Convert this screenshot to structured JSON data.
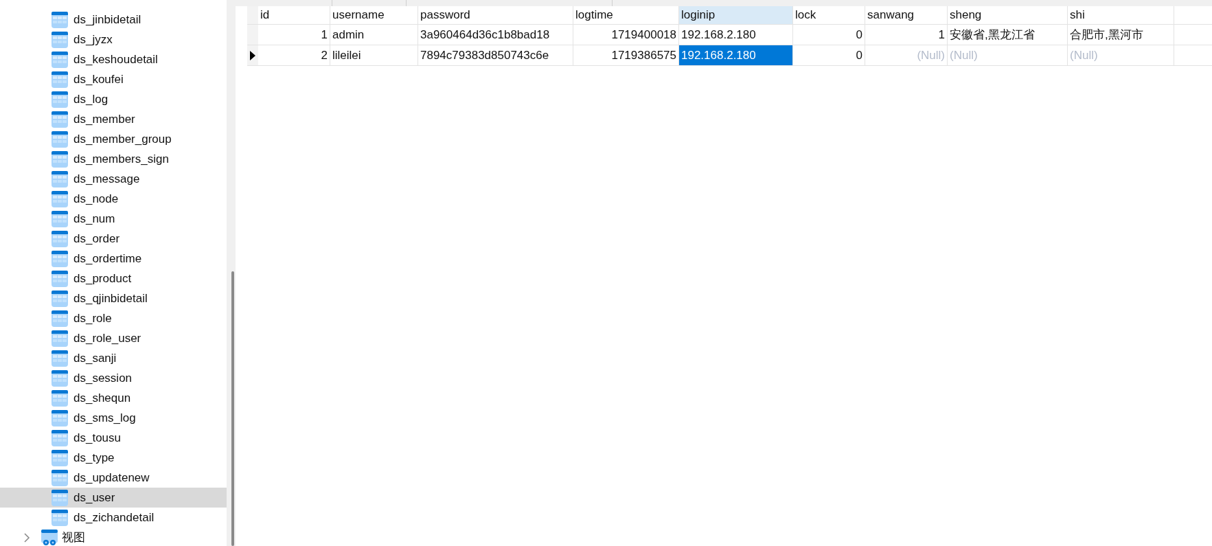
{
  "sidebar": {
    "items": [
      {
        "name": "ds_jinbidetail",
        "selected": false
      },
      {
        "name": "ds_jyzx",
        "selected": false
      },
      {
        "name": "ds_keshoudetail",
        "selected": false
      },
      {
        "name": "ds_koufei",
        "selected": false
      },
      {
        "name": "ds_log",
        "selected": false
      },
      {
        "name": "ds_member",
        "selected": false
      },
      {
        "name": "ds_member_group",
        "selected": false
      },
      {
        "name": "ds_members_sign",
        "selected": false
      },
      {
        "name": "ds_message",
        "selected": false
      },
      {
        "name": "ds_node",
        "selected": false
      },
      {
        "name": "ds_num",
        "selected": false
      },
      {
        "name": "ds_order",
        "selected": false
      },
      {
        "name": "ds_ordertime",
        "selected": false
      },
      {
        "name": "ds_product",
        "selected": false
      },
      {
        "name": "ds_qjinbidetail",
        "selected": false
      },
      {
        "name": "ds_role",
        "selected": false
      },
      {
        "name": "ds_role_user",
        "selected": false
      },
      {
        "name": "ds_sanji",
        "selected": false
      },
      {
        "name": "ds_session",
        "selected": false
      },
      {
        "name": "ds_shequn",
        "selected": false
      },
      {
        "name": "ds_sms_log",
        "selected": false
      },
      {
        "name": "ds_tousu",
        "selected": false
      },
      {
        "name": "ds_type",
        "selected": false
      },
      {
        "name": "ds_updatenew",
        "selected": false
      },
      {
        "name": "ds_user",
        "selected": true
      },
      {
        "name": "ds_zichandetail",
        "selected": false
      }
    ],
    "folder": {
      "label": "视图",
      "expanded": false
    }
  },
  "table": {
    "columns": [
      {
        "label": "id",
        "kind": "number",
        "selected": false
      },
      {
        "label": "username",
        "kind": "text",
        "selected": false
      },
      {
        "label": "password",
        "kind": "text",
        "selected": false
      },
      {
        "label": "logtime",
        "kind": "number",
        "selected": false
      },
      {
        "label": "loginip",
        "kind": "text",
        "selected": true
      },
      {
        "label": "lock",
        "kind": "number",
        "selected": false
      },
      {
        "label": "sanwang",
        "kind": "number",
        "selected": false
      },
      {
        "label": "sheng",
        "kind": "text",
        "selected": false
      },
      {
        "label": "shi",
        "kind": "text",
        "selected": false
      }
    ],
    "rows": [
      {
        "current": false,
        "cells": [
          {
            "text": "1",
            "null": false,
            "selected": false
          },
          {
            "text": "admin",
            "null": false,
            "selected": false
          },
          {
            "text": "3a960464d36c1b8bad18",
            "null": false,
            "selected": false
          },
          {
            "text": "1719400018",
            "null": false,
            "selected": false
          },
          {
            "text": "192.168.2.180",
            "null": false,
            "selected": false
          },
          {
            "text": "0",
            "null": false,
            "selected": false
          },
          {
            "text": "1",
            "null": false,
            "selected": false
          },
          {
            "text": "安徽省,黑龙江省",
            "null": false,
            "selected": false
          },
          {
            "text": "合肥市,黑河市",
            "null": false,
            "selected": false
          }
        ]
      },
      {
        "current": true,
        "cells": [
          {
            "text": "2",
            "null": false,
            "selected": false
          },
          {
            "text": "lileilei",
            "null": false,
            "selected": false
          },
          {
            "text": "7894c79383d850743c6e",
            "null": false,
            "selected": false
          },
          {
            "text": "1719386575",
            "null": false,
            "selected": false
          },
          {
            "text": "192.168.2.180",
            "null": false,
            "selected": true
          },
          {
            "text": "0",
            "null": false,
            "selected": false
          },
          {
            "text": "(Null)",
            "null": true,
            "selected": false
          },
          {
            "text": "(Null)",
            "null": true,
            "selected": false
          },
          {
            "text": "(Null)",
            "null": true,
            "selected": false
          }
        ]
      }
    ]
  }
}
